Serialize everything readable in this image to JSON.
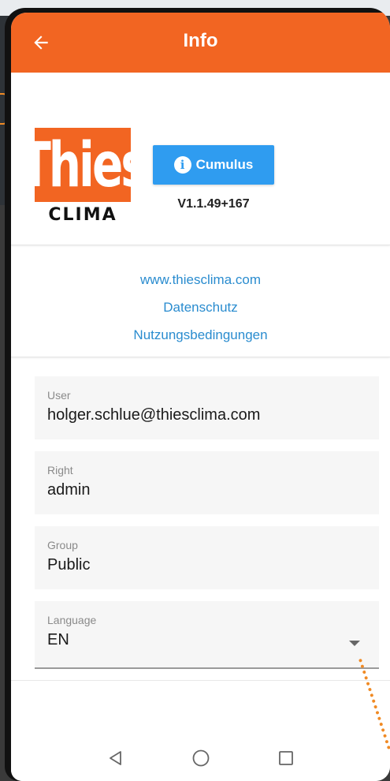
{
  "appbar": {
    "title": "Info",
    "back_icon": "arrow-left-icon"
  },
  "logo": {
    "word": "Thies",
    "sub": "CLIMA",
    "brand_color": "#f26522"
  },
  "app_button": {
    "label": "Cumulus",
    "icon": "info-icon",
    "color": "#2f9cf0"
  },
  "version": "V1.1.49+167",
  "links": [
    {
      "label": "www.thiesclima.com"
    },
    {
      "label": "Datenschutz"
    },
    {
      "label": "Nutzungsbedingungen"
    }
  ],
  "fields": {
    "user": {
      "label": "User",
      "value": "holger.schlue@thiesclima.com"
    },
    "right": {
      "label": "Right",
      "value": "admin"
    },
    "group": {
      "label": "Group",
      "value": "Public"
    },
    "language": {
      "label": "Language",
      "value": "EN"
    }
  },
  "navbar": {
    "back": "triangle-back-icon",
    "home": "circle-home-icon",
    "recents": "square-recents-icon"
  },
  "colors": {
    "accent": "#f26522",
    "link": "#2a8ccf"
  }
}
